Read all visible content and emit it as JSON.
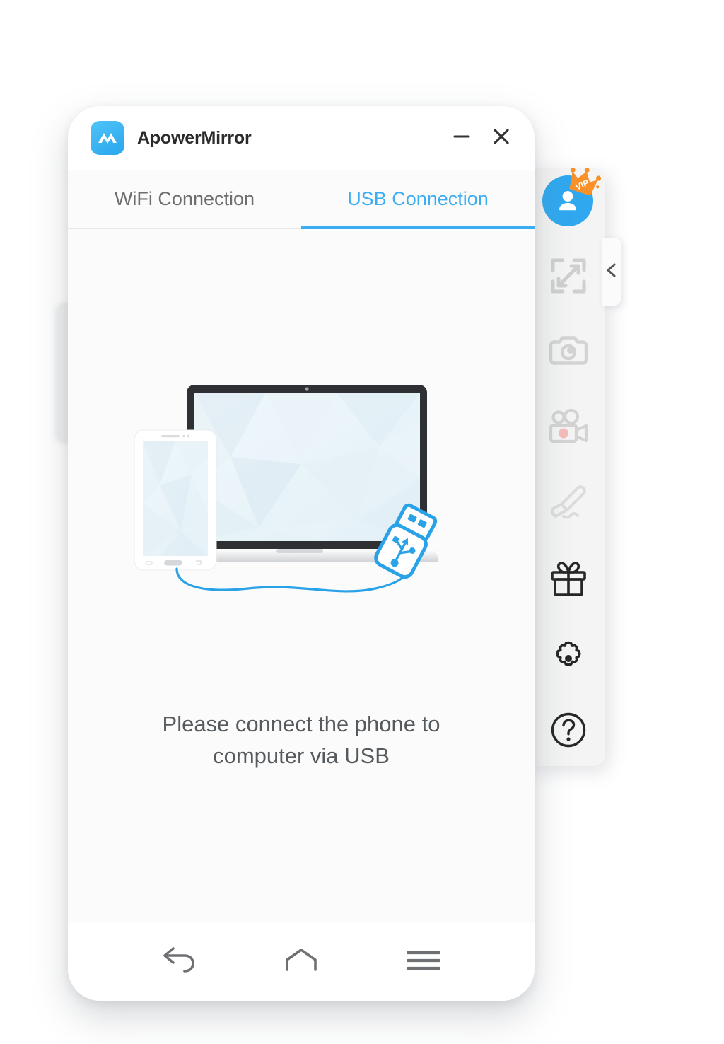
{
  "window": {
    "app_title": "ApowerMirror",
    "logo_icon": "apowermirror-logo-icon",
    "minimize_label": "–",
    "minimize_icon": "minimize-icon",
    "close_label": "×",
    "close_icon": "close-icon",
    "accent_color": "#3cadf2",
    "background_color": "#fbfbfb"
  },
  "tabs": [
    {
      "label": "WiFi Connection",
      "active": false
    },
    {
      "label": "USB Connection",
      "active": true
    }
  ],
  "content": {
    "illustration_icon": "laptop-phone-usb-illustration",
    "hint_line1": "Please connect the phone to",
    "hint_line2": "computer via USB",
    "hint_text": "Please connect the phone to computer via USB"
  },
  "sidebar": {
    "collapse_icon": "chevron-left-icon",
    "items": [
      {
        "icon": "user-avatar-icon",
        "label": "Account",
        "badge": "VIP",
        "badge_icon": "vip-crown-icon",
        "state": "active"
      },
      {
        "icon": "fullscreen-expand-icon",
        "label": "Full Screen",
        "state": "disabled"
      },
      {
        "icon": "camera-icon",
        "label": "Screenshot",
        "state": "disabled"
      },
      {
        "icon": "video-recorder-icon",
        "label": "Record",
        "state": "disabled"
      },
      {
        "icon": "brush-icon",
        "label": "Whiteboard",
        "state": "disabled"
      },
      {
        "icon": "gift-icon",
        "label": "Gift",
        "state": "enabled"
      },
      {
        "icon": "gear-icon",
        "label": "Settings",
        "state": "enabled"
      },
      {
        "icon": "help-question-icon",
        "label": "Help",
        "state": "enabled"
      }
    ]
  },
  "navbar": {
    "items": [
      {
        "icon": "back-arrow-icon",
        "label": "Back"
      },
      {
        "icon": "home-icon",
        "label": "Home"
      },
      {
        "icon": "menu-icon",
        "label": "Menu"
      }
    ]
  }
}
